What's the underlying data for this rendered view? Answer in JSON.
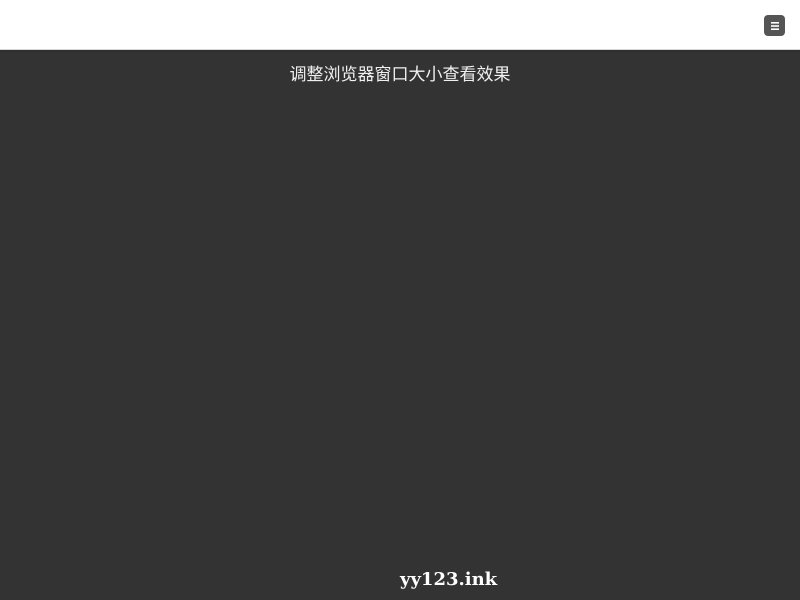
{
  "header": {
    "menu_icon": "hamburger-menu-icon"
  },
  "main": {
    "hint_text": "调整浏览器窗口大小查看效果"
  },
  "footer": {
    "watermark_text": "yy123.ink"
  },
  "colors": {
    "page_background": "#333333",
    "header_background": "#ffffff",
    "menu_button": "#555555",
    "text": "#f0f0f0"
  }
}
